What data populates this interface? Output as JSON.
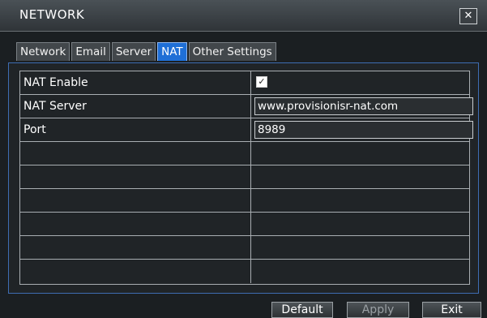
{
  "window": {
    "title": "NETWORK",
    "close_glyph": "✕"
  },
  "tabs": [
    {
      "label": "Network"
    },
    {
      "label": "Email"
    },
    {
      "label": "Server"
    },
    {
      "label": "NAT",
      "active": true
    },
    {
      "label": "Other Settings"
    }
  ],
  "settings": {
    "nat_enable": {
      "label": "NAT Enable",
      "checked": true,
      "check_glyph": "✓"
    },
    "nat_server": {
      "label": "NAT Server",
      "value": "www.provisionisr-nat.com"
    },
    "port": {
      "label": "Port",
      "value": "8989"
    }
  },
  "footer": {
    "default_label": "Default",
    "apply_label": "Apply",
    "exit_label": "Exit"
  },
  "colors": {
    "accent": "#1f6fd6",
    "panel_border": "#3e6db3"
  }
}
